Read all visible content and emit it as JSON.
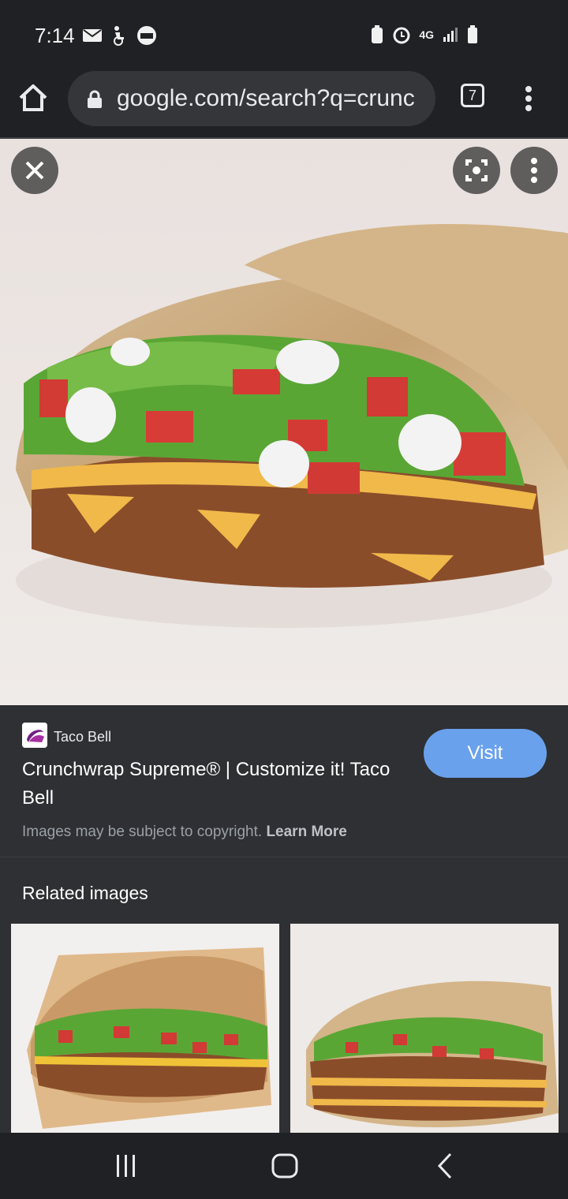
{
  "status_bar": {
    "time": "7:14",
    "network": "4G"
  },
  "browser": {
    "url": "google.com/search?q=crunc",
    "tab_count": "7"
  },
  "result": {
    "source_name": "Taco Bell",
    "title": "Crunchwrap Supreme® | Customize it! Taco Bell",
    "visit_label": "Visit",
    "copyright_text": "Images may be subject to copyright.",
    "learn_more": "Learn More"
  },
  "related": {
    "title": "Related images"
  },
  "icons": {
    "home": "home-icon",
    "lock": "lock-icon",
    "menu": "more-vert-icon",
    "close": "close-icon",
    "lens": "lens-icon",
    "back": "back-icon",
    "recents": "recents-icon",
    "nav_home": "nav-home-icon"
  },
  "colors": {
    "accent": "#6aa1ec",
    "panel": "#2f3033",
    "background": "#202124"
  }
}
